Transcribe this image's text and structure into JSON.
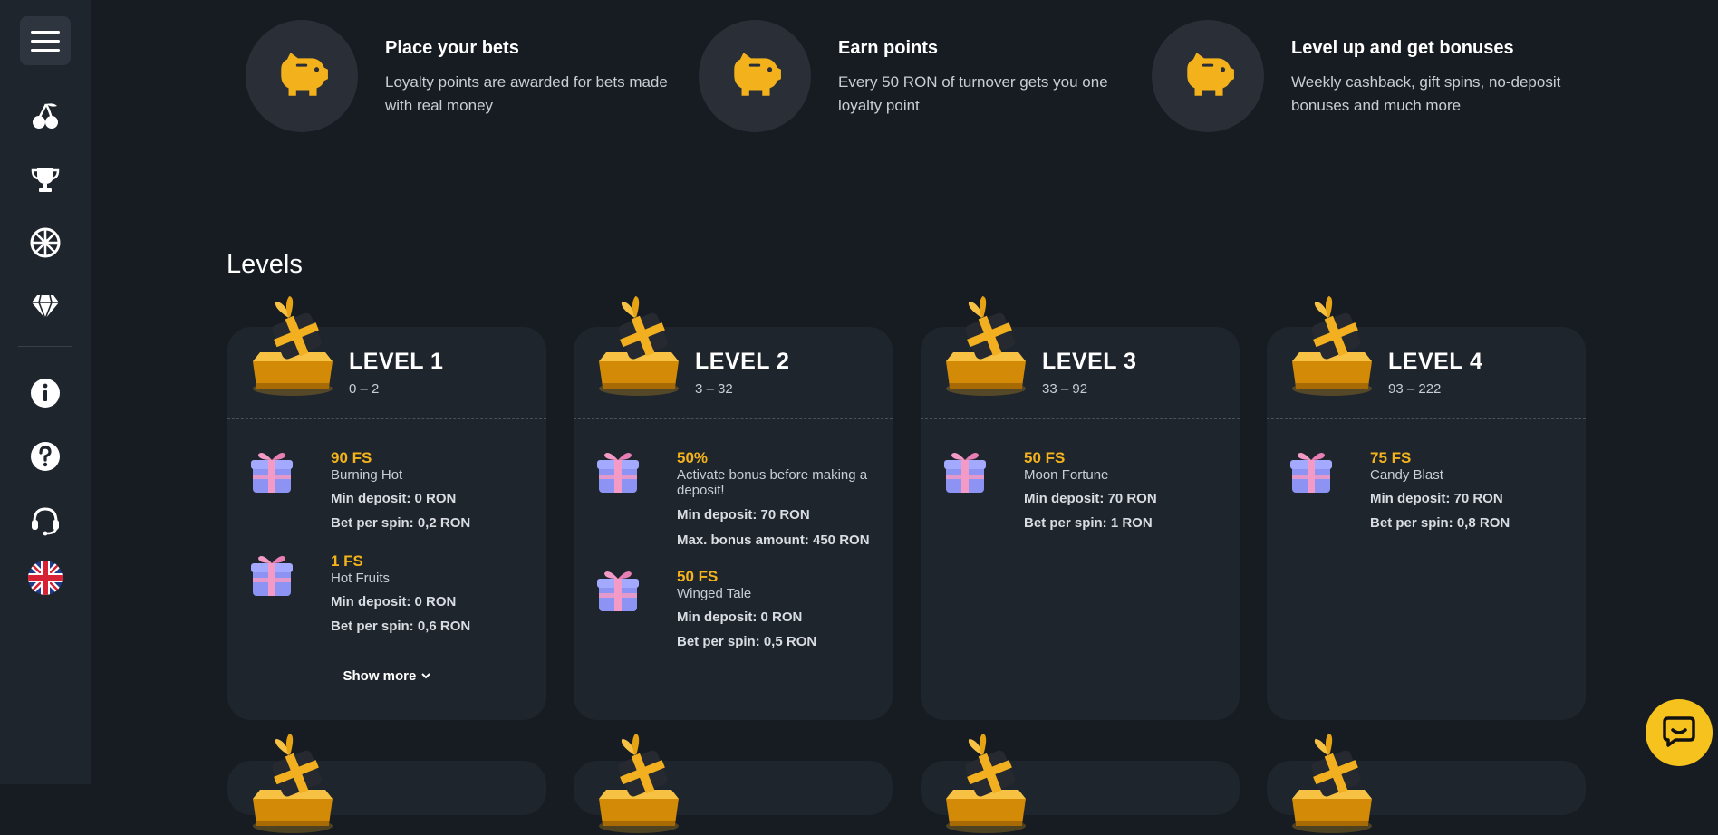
{
  "sidebar": {
    "icons": [
      "menu-icon",
      "cherry-icon",
      "trophy-icon",
      "wheel-icon",
      "diamond-icon",
      "info-icon",
      "help-icon",
      "support-headset-icon",
      "uk-flag-icon"
    ]
  },
  "steps": [
    {
      "title": "Place your bets",
      "text": "Loyalty points are awarded for bets made with real money",
      "icon": "piggy-bank-icon"
    },
    {
      "title": "Earn points",
      "text": "Every 50 RON of turnover gets you one loyalty point",
      "icon": "piggy-bank-icon"
    },
    {
      "title": "Level up and get bonuses",
      "text": "Weekly cashback, gift spins, no-deposit bonuses and much more",
      "icon": "piggy-bank-icon"
    }
  ],
  "levels_title": "Levels",
  "levels": [
    {
      "name": "LEVEL 1",
      "range": "0 – 2",
      "bonuses": [
        {
          "amount": "90 FS",
          "game": "Burning Hot",
          "lines": [
            "Min deposit: 0 RON",
            "Bet per spin: 0,2 RON"
          ]
        },
        {
          "amount": "1 FS",
          "game": "Hot Fruits",
          "lines": [
            "Min deposit: 0 RON",
            "Bet per spin: 0,6 RON"
          ]
        }
      ],
      "show_more": "Show more"
    },
    {
      "name": "LEVEL 2",
      "range": "3 – 32",
      "bonuses": [
        {
          "amount": "50%",
          "game": "Activate bonus before making a deposit!",
          "lines": [
            "Min deposit: 70 RON",
            "Max. bonus amount: 450 RON"
          ]
        },
        {
          "amount": "50 FS",
          "game": "Winged Tale",
          "lines": [
            "Min deposit: 0 RON",
            "Bet per spin: 0,5 RON"
          ]
        }
      ]
    },
    {
      "name": "LEVEL 3",
      "range": "33 – 92",
      "bonuses": [
        {
          "amount": "50 FS",
          "game": "Moon Fortune",
          "lines": [
            "Min deposit: 70 RON",
            "Bet per spin: 1 RON"
          ]
        }
      ]
    },
    {
      "name": "LEVEL 4",
      "range": "93 – 222",
      "bonuses": [
        {
          "amount": "75 FS",
          "game": "Candy Blast",
          "lines": [
            "Min deposit: 70 RON",
            "Bet per spin: 0,8 RON"
          ]
        }
      ]
    }
  ],
  "colors": {
    "accent": "#f4b31b",
    "background": "#171c23",
    "card": "#1f252d",
    "chat": "#f6c31e"
  }
}
